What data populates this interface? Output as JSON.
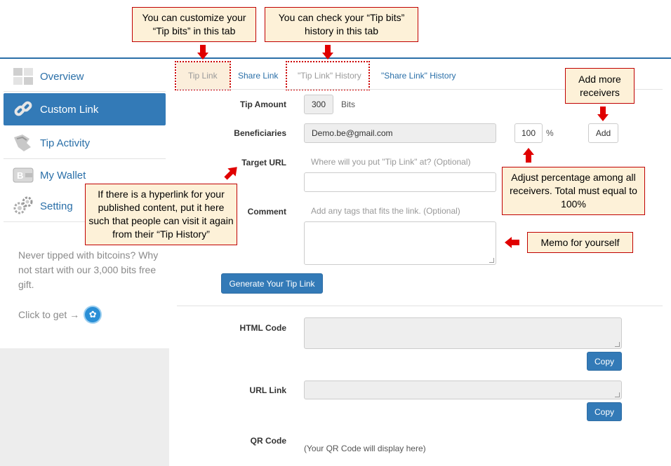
{
  "sidebar": {
    "items": [
      {
        "label": "Overview",
        "icon": "overview-grid-icon"
      },
      {
        "label": "Custom Link",
        "icon": "chain-link-icon",
        "active": true
      },
      {
        "label": "Tip Activity",
        "icon": "tip-hand-icon"
      },
      {
        "label": "My Wallet",
        "icon": "wallet-icon"
      },
      {
        "label": "Setting",
        "icon": "gears-icon"
      }
    ],
    "promo_text": "Never tipped with bitcoins? Why not start with our 3,000 bits free gift.",
    "promo_click": "Click to get →"
  },
  "tabs": [
    {
      "label": "Tip Link",
      "active": true
    },
    {
      "label": "Share Link"
    },
    {
      "label": "\"Tip Link\" History"
    },
    {
      "label": "\"Share Link\" History"
    }
  ],
  "form": {
    "tip_amount_label": "Tip Amount",
    "tip_amount_value": "300",
    "tip_amount_unit": "Bits",
    "beneficiaries_label": "Beneficiaries",
    "beneficiary_email": "Demo.be@gmail.com",
    "beneficiary_percent": "100",
    "percent_sign": "%",
    "add_button": "Add",
    "target_url_label": "Target URL",
    "target_url_placeholder": "Where will you put \"Tip Link\" at? (Optional)",
    "comment_label": "Comment",
    "comment_placeholder": "Add any tags that fits the link. (Optional)",
    "generate_button": "Generate Your Tip Link",
    "html_code_label": "HTML Code",
    "copy_button_1": "Copy",
    "url_link_label": "URL Link",
    "copy_button_2": "Copy",
    "qr_code_label": "QR Code",
    "qr_code_note": "(Your QR Code will display here)"
  },
  "callouts": {
    "customize": "You can customize your “Tip bits” in this tab",
    "history": "You can check your “Tip bits” history in this tab",
    "add_more": "Add more receivers",
    "hyperlink": "If there is a hyperlink for your published content, put it here such that people can visit it again from their “Tip History”",
    "adjust": "Adjust percentage among all receivers. Total must equal to 100%",
    "memo": "Memo for yourself"
  },
  "colors": {
    "accent": "#337ab7",
    "link": "#2a6fa8",
    "callout_bg": "#fdf1d8",
    "callout_border": "#c00000",
    "arrow": "#e00000"
  }
}
